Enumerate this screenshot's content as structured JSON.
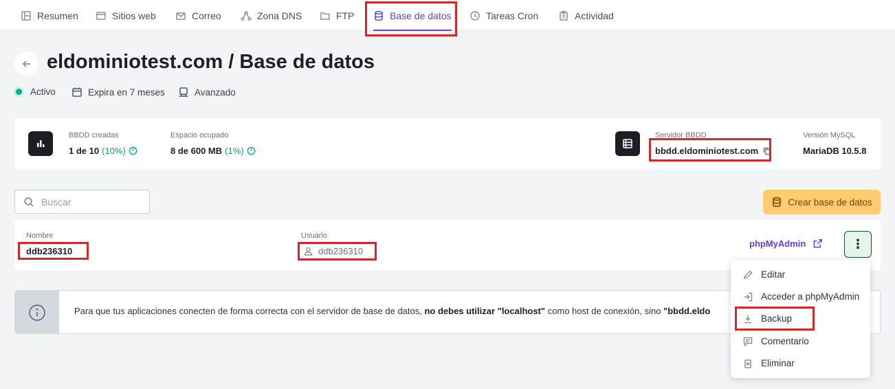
{
  "tabs": [
    {
      "label": "Resumen",
      "icon": "layout-icon"
    },
    {
      "label": "Sitios web",
      "icon": "browser-icon"
    },
    {
      "label": "Correo",
      "icon": "mail-icon"
    },
    {
      "label": "Zona DNS",
      "icon": "network-icon"
    },
    {
      "label": "FTP",
      "icon": "folder-icon"
    },
    {
      "label": "Base de datos",
      "icon": "database-icon",
      "active": true
    },
    {
      "label": "Tareas Cron",
      "icon": "clock-icon"
    },
    {
      "label": "Actividad",
      "icon": "clipboard-icon"
    }
  ],
  "header": {
    "title": "eldominiotest.com / Base de datos",
    "status": "Activo",
    "expiry": "Expira en 7 meses",
    "plan": "Avanzado"
  },
  "stats": {
    "dbs_label": "BBDD creadas",
    "dbs_value": "1 de 10",
    "dbs_pct": "(10%)",
    "space_label": "Espacio ocupado",
    "space_value": "8 de 600 MB",
    "space_pct": "(1%)",
    "server_label": "Servidor BBDD",
    "server_value": "bbdd.eldominiotest.com",
    "version_label": "Versión MySQL",
    "version_value": "MariaDB 10.5.8"
  },
  "search": {
    "placeholder": "Buscar"
  },
  "create_button": "Crear base de datos",
  "db_row": {
    "name_label": "Nombre",
    "name_value": "ddb236310",
    "user_label": "Usuario",
    "user_value": "ddb236310",
    "pma_label": "phpMyAdmin",
    "kebab": "⋮"
  },
  "info": {
    "text_1": "Para que tus aplicaciones conecten de forma correcta con el servidor de base de datos, ",
    "bold_1": "no debes utilizar \"localhost\"",
    "text_2": " como host de conexión, sino ",
    "bold_2": "\"bbdd.eldo"
  },
  "menu": {
    "edit": "Editar",
    "access": "Acceder a phpMyAdmin",
    "backup": "Backup",
    "comment": "Comentario",
    "delete": "Eliminar"
  },
  "colors": {
    "accent": "#673de6",
    "highlight": "#d5262b",
    "create_bg": "#ffcd6e",
    "success": "#00b090"
  }
}
